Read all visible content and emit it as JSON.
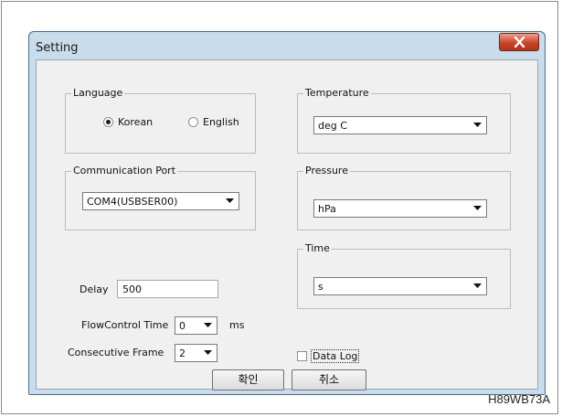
{
  "window": {
    "title": "Setting",
    "close_icon": "close-icon"
  },
  "language": {
    "legend": "Language",
    "options": [
      {
        "label": "Korean",
        "selected": true
      },
      {
        "label": "English",
        "selected": false
      }
    ]
  },
  "communication_port": {
    "legend": "Communication Port",
    "value": "COM4(USBSER00)"
  },
  "temperature": {
    "legend": "Temperature",
    "value": "deg C"
  },
  "pressure": {
    "legend": "Pressure",
    "value": "hPa"
  },
  "time": {
    "legend": "Time",
    "value": "s"
  },
  "delay": {
    "label": "Delay",
    "value": "500"
  },
  "flow_control": {
    "label": "FlowControl Time",
    "value": "0",
    "unit": "ms"
  },
  "consecutive_frame": {
    "label": "Consecutive Frame",
    "value": "2"
  },
  "data_log": {
    "label": "Data Log",
    "checked": false
  },
  "buttons": {
    "ok": "확인",
    "cancel": "취소"
  },
  "caption": "H89WB73A"
}
